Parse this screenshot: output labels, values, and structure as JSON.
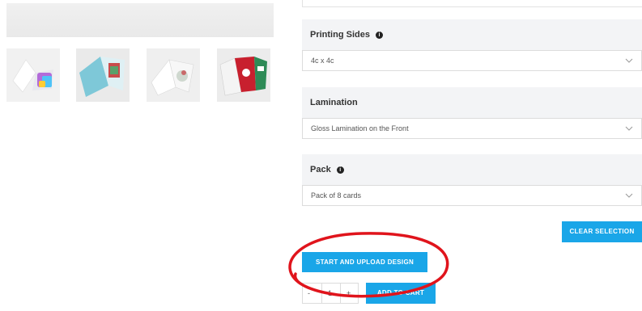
{
  "options": [
    {
      "label": "Printing Sides",
      "has_info": true,
      "value": "4c x 4c"
    },
    {
      "label": "Lamination",
      "has_info": false,
      "value": "Gloss Lamination on the Front"
    },
    {
      "label": "Pack",
      "has_info": true,
      "value": "Pack of 8 cards"
    }
  ],
  "buttons": {
    "clear": "CLEAR SELECTION",
    "upload": "START AND UPLOAD DESIGN",
    "add_to_cart": "ADD TO CART"
  },
  "quantity": {
    "minus": "-",
    "value": "1",
    "plus": "+"
  },
  "icons": {
    "info": "info-icon",
    "dropdown": "chevron-down-icon"
  },
  "colors": {
    "accent": "#1aa6e8",
    "annotation": "#e0141c"
  }
}
